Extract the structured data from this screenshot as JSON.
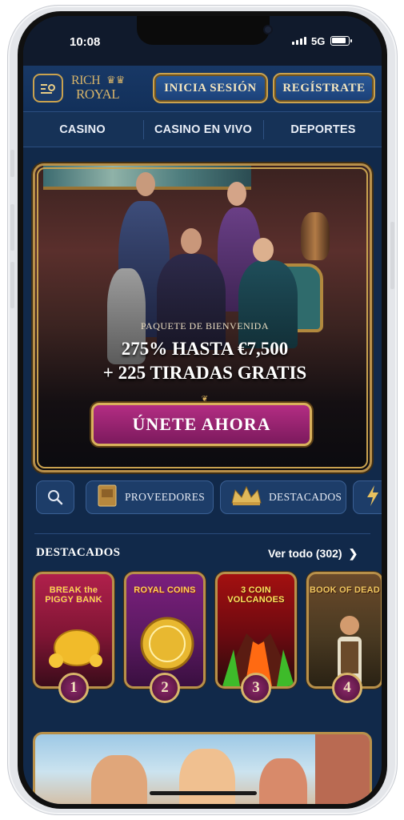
{
  "status": {
    "time": "10:08",
    "network": "5G"
  },
  "header": {
    "logo_line1": "RICH",
    "logo_line2": "ROYAL",
    "login_label": "INICIA SESIÓN",
    "register_label": "REGÍSTRATE"
  },
  "nav": {
    "items": [
      "CASINO",
      "CASINO EN VIVO",
      "DEPORTES"
    ]
  },
  "banner": {
    "subtitle": "PAQUETE DE BIENVENIDA",
    "line1": "275% HASTA €7,500",
    "line2": "+ 225 TIRADAS GRATIS",
    "cta": "ÚNETE AHORA"
  },
  "filters": {
    "providers": "PROVEEDORES",
    "featured": "DESTACADOS"
  },
  "featured": {
    "title": "DESTACADOS",
    "view_all": "Ver todo (302)",
    "games": [
      {
        "name": "BREAK the PIGGY BANK",
        "rank": "1"
      },
      {
        "name": "ROYAL COINS",
        "rank": "2"
      },
      {
        "name": "3 COIN VOLCANOES",
        "rank": "3"
      },
      {
        "name": "BOOK OF DEAD",
        "rank": "4"
      }
    ]
  },
  "colors": {
    "gold": "#c9a24f",
    "navy": "#11294a",
    "magenta": "#9a2474"
  },
  "icons": [
    "menu-search-icon",
    "search-icon",
    "book-icon",
    "crown-icon",
    "lightning-icon",
    "chevron-right-icon"
  ]
}
